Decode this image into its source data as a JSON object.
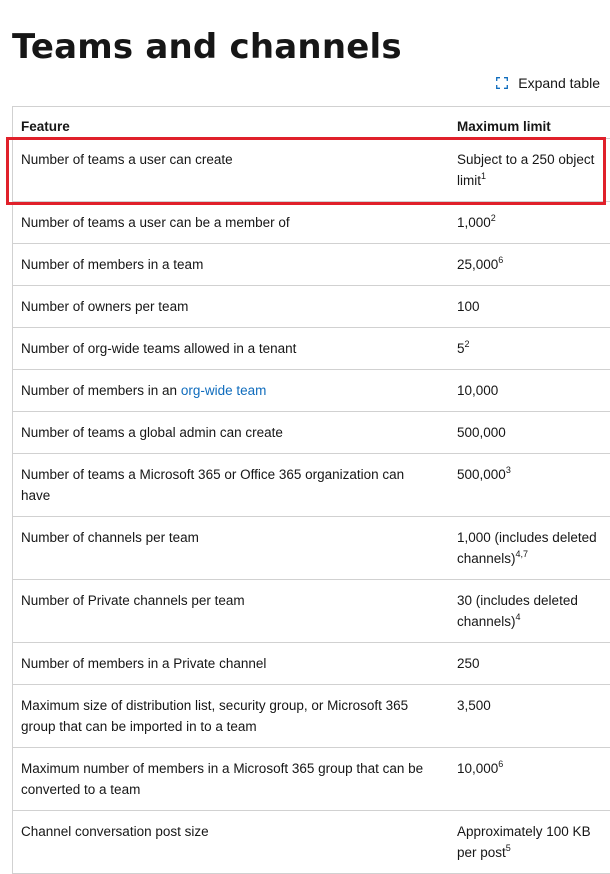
{
  "page": {
    "title": "Teams and channels",
    "expand_label": "Expand table",
    "highlight_color": "#e0202a",
    "link_color": "#0f6cbd"
  },
  "table": {
    "headers": [
      "Feature",
      "Maximum limit"
    ],
    "rows": [
      {
        "feature": "Number of teams a user can create",
        "limit": "Subject to a 250 object limit",
        "sup": "1"
      },
      {
        "feature": "Number of teams a user can be a member of",
        "limit": "1,000",
        "sup": "2"
      },
      {
        "feature": "Number of members in a team",
        "limit": "25,000",
        "sup": "6"
      },
      {
        "feature": "Number of owners per team",
        "limit": "100",
        "sup": ""
      },
      {
        "feature": "Number of org-wide teams allowed in a tenant",
        "limit": "5",
        "sup": "2"
      },
      {
        "feature_prefix": "Number of members in an ",
        "feature_link": "org-wide team",
        "limit": "10,000",
        "sup": ""
      },
      {
        "feature": "Number of teams a global admin can create",
        "limit": "500,000",
        "sup": ""
      },
      {
        "feature": "Number of teams a Microsoft 365 or Office 365 organization can have",
        "limit": "500,000",
        "sup": "3"
      },
      {
        "feature": "Number of channels per team",
        "limit": "1,000 (includes deleted channels)",
        "sup": "4,7"
      },
      {
        "feature": "Number of Private channels per team",
        "limit": "30 (includes deleted channels)",
        "sup": "4"
      },
      {
        "feature": "Number of members in a Private channel",
        "limit": "250",
        "sup": ""
      },
      {
        "feature": "Maximum size of distribution list, security group, or Microsoft 365 group that can be imported in to a team",
        "limit": "3,500",
        "sup": ""
      },
      {
        "feature": "Maximum number of members in a Microsoft 365 group that can be converted to a team",
        "limit": "10,000",
        "sup": "6"
      },
      {
        "feature": "Channel conversation post size",
        "limit": "Approximately 100 KB per post",
        "sup": "5"
      }
    ]
  }
}
